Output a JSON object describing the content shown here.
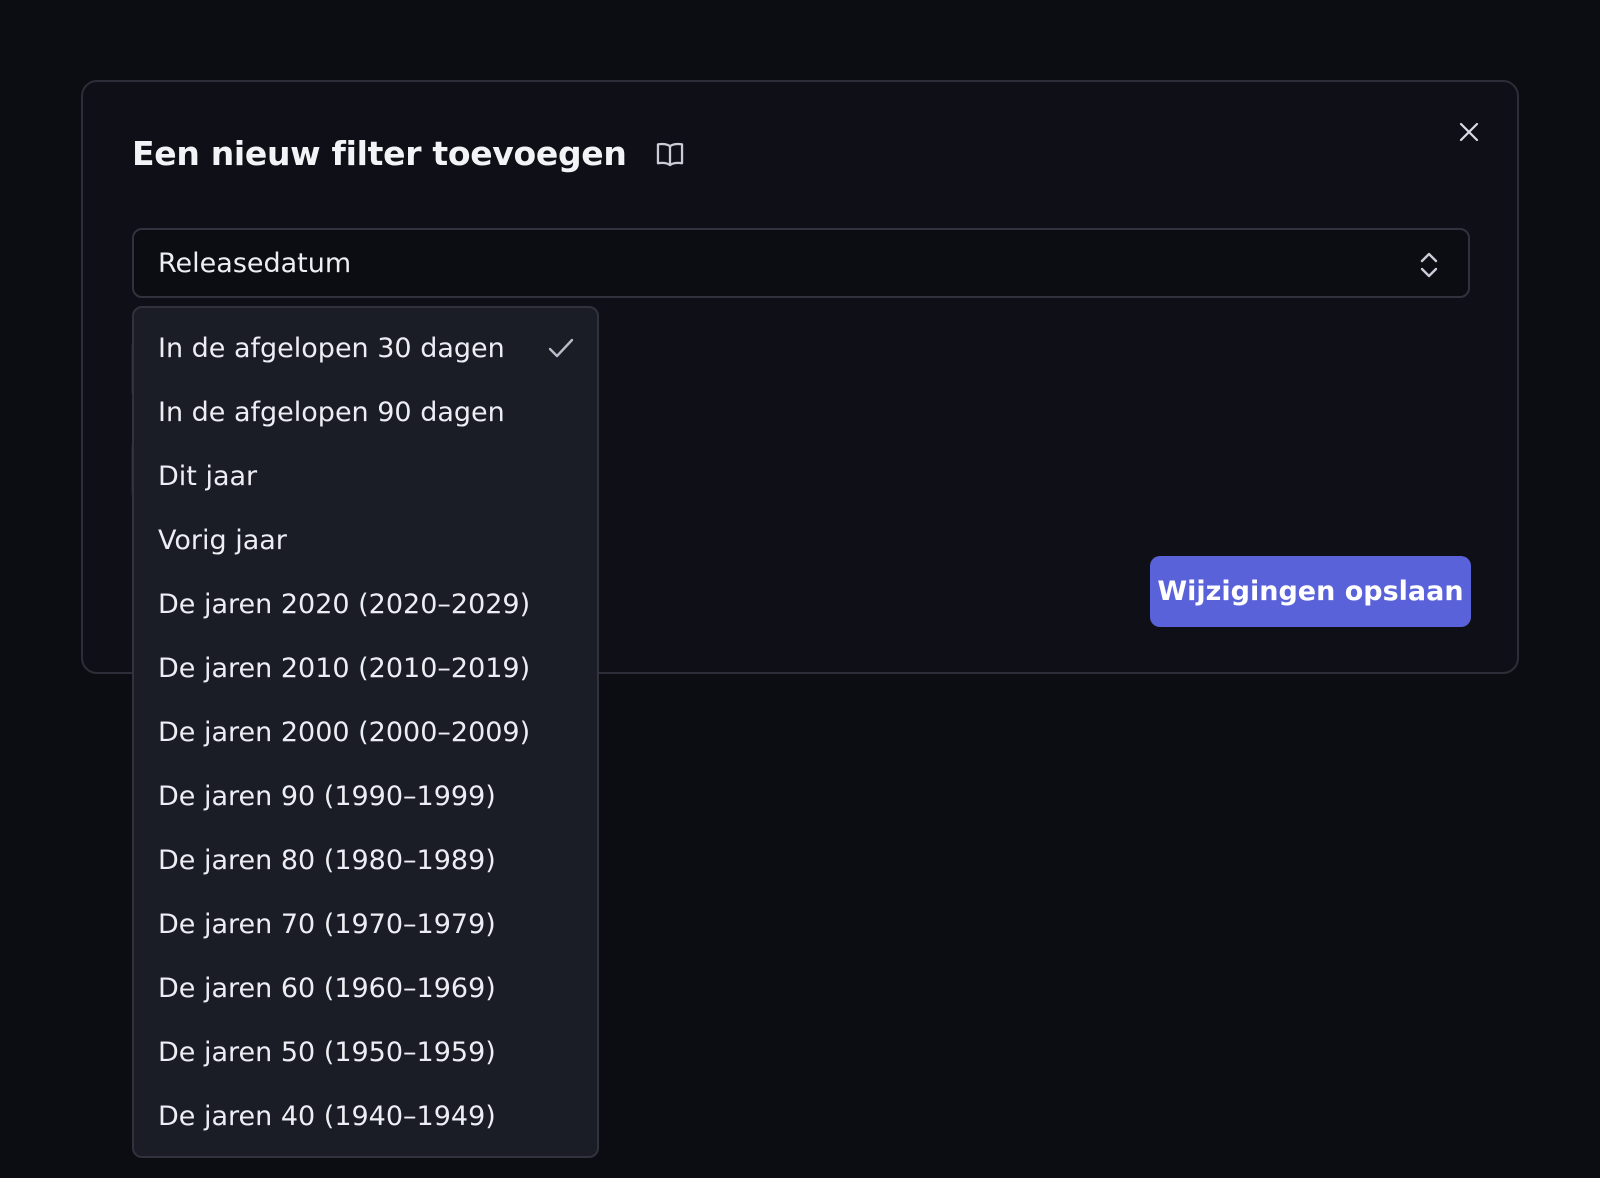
{
  "modal": {
    "title": "Een nieuw filter toevoegen",
    "title_icon": "book-open-icon",
    "close_icon": "close-icon"
  },
  "filter_select": {
    "value": "Releasedatum",
    "icon": "chevron-up-down-icon"
  },
  "dropdown": {
    "selected_index": 0,
    "selected_icon": "check-icon",
    "options": [
      "In de afgelopen 30 dagen",
      "In de afgelopen 90 dagen",
      "Dit jaar",
      "Vorig jaar",
      "De jaren 2020 (2020–2029)",
      "De jaren 2010 (2010–2019)",
      "De jaren 2000 (2000–2009)",
      "De jaren 90 (1990–1999)",
      "De jaren 80 (1980–1989)",
      "De jaren 70 (1970–1979)",
      "De jaren 60 (1960–1969)",
      "De jaren 50 (1950–1959)",
      "De jaren 40 (1940–1949)"
    ]
  },
  "actions": {
    "save_label": "Wijzigingen opslaan"
  },
  "colors": {
    "background": "#0c0d12",
    "modal_background": "#0f1017",
    "dropdown_background": "#1a1c26",
    "primary_button": "#5a62d9",
    "border": "#30333e"
  }
}
